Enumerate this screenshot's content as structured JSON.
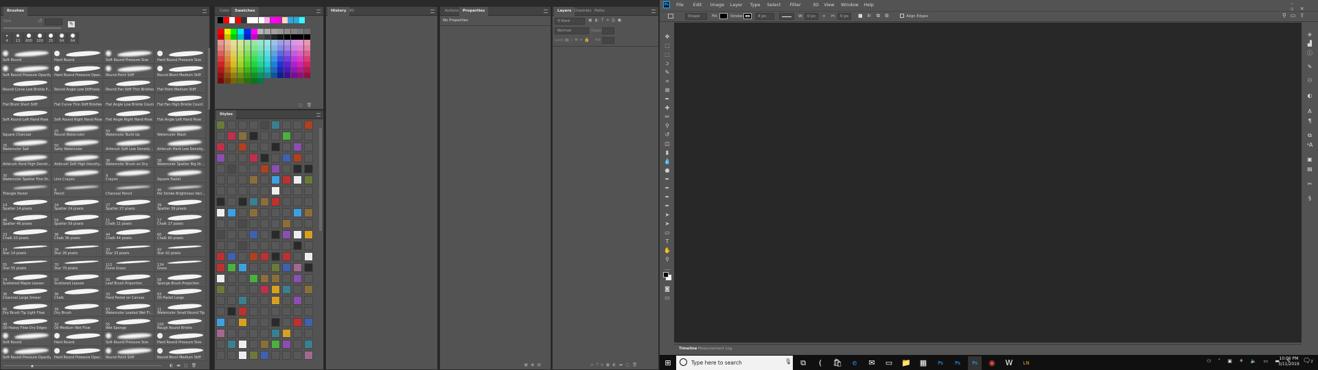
{
  "brushes_panel": {
    "tab": "Brushes",
    "size_label": "Size",
    "presets": [
      "4",
      "13",
      "600",
      "100",
      "25",
      "64",
      "64"
    ],
    "rows": [
      [
        [
          "Soft Round",
          ""
        ],
        [
          "Hard Round",
          ""
        ],
        [
          "Soft Round Pressure Size",
          ""
        ],
        [
          "Hard Round Pressure Size",
          ""
        ]
      ],
      [
        [
          "Soft Round Pressure Opacity",
          ""
        ],
        [
          "Hard Round Pressure Opacity",
          ""
        ],
        [
          "Round Point Stiff",
          ""
        ],
        [
          "Round Blunt Medium Stiff",
          ""
        ]
      ],
      [
        [
          "Round Curve Low Bristle Per...",
          ""
        ],
        [
          "Round Angle Low Stiffness",
          ""
        ],
        [
          "Round Fan Stiff Thin Bristles",
          ""
        ],
        [
          "Flat Point Medium Stiff",
          ""
        ]
      ],
      [
        [
          "Flat Blunt Short Stiff",
          ""
        ],
        [
          "Flat Curve Thin Stiff Bristles",
          ""
        ],
        [
          "Flat Angle Low Bristle Count",
          ""
        ],
        [
          "Flat Fan High Bristle Count",
          ""
        ]
      ],
      [
        [
          "Soft Round Left Hand Pose",
          ""
        ],
        [
          "Soft Round Right Hand Pose",
          ""
        ],
        [
          "Flat Angle Right Hand Pose",
          ""
        ],
        [
          "Flat Angle Left Hand Pose",
          ""
        ]
      ],
      [
        [
          "Square Charcoal",
          ""
        ],
        [
          "Round Watercolor",
          "25"
        ],
        [
          "Watercolor Build Up",
          "50"
        ],
        [
          "Watercolor Wash",
          ""
        ]
      ],
      [
        [
          "Watercolor Salt",
          "25"
        ],
        [
          "Salty Watercolor",
          "50"
        ],
        [
          "Airbrush Soft Low Density G...",
          ""
        ],
        [
          "Airbrush Hard Low Density...",
          ""
        ]
      ],
      [
        [
          "Airbrush Hard High Density...",
          ""
        ],
        [
          "Airbrush Soft High Density...",
          ""
        ],
        [
          "Watercolor Brush on Dry",
          "36"
        ],
        [
          "Watercolor Spatter Big Drops",
          "38"
        ]
      ],
      [
        [
          "Watercolor Spatter Fine Drops",
          "30"
        ],
        [
          "Lino Crayon",
          ""
        ],
        [
          "Crayon",
          "9"
        ],
        [
          "Square Pastel",
          ""
        ]
      ],
      [
        [
          "Triangle Pastel",
          ""
        ],
        [
          "Pencil",
          "9"
        ],
        [
          "Charcoal Pencil",
          ""
        ],
        [
          "Per Stroke Brightness Varia...",
          "45"
        ]
      ],
      [
        [
          "Spatter 14 pixels",
          "14"
        ],
        [
          "Spatter 24 pixels",
          "24"
        ],
        [
          "Spatter 27 pixels",
          "27"
        ],
        [
          "Spatter 39 pixels",
          "39"
        ]
      ],
      [
        [
          "Spatter 46 pixels",
          "46"
        ],
        [
          "Spatter 59 pixels",
          "59"
        ],
        [
          "Chalk 11 pixels",
          "11"
        ],
        [
          "Chalk 17 pixels",
          "17"
        ]
      ],
      [
        [
          "Chalk 23 pixels",
          "23"
        ],
        [
          "Chalk 36 pixels",
          "36"
        ],
        [
          "Chalk 44 pixels",
          "44"
        ],
        [
          "Chalk 60 pixels",
          "60"
        ]
      ],
      [
        [
          "Star 14 pixels",
          "14"
        ],
        [
          "Star 26 pixels",
          "26"
        ],
        [
          "Star 33 pixels",
          "33"
        ],
        [
          "Star 42 pixels",
          "42"
        ]
      ],
      [
        [
          "Star 55 pixels",
          "55"
        ],
        [
          "Star 70 pixels",
          "70"
        ],
        [
          "Dune Grass",
          "112"
        ],
        [
          "Grass",
          "134"
        ]
      ],
      [
        [
          "Scattered Maple Leaves",
          "74"
        ],
        [
          "Scattered Leaves",
          "55"
        ],
        [
          "Leaf Brush Projection",
          "55"
        ],
        [
          "Sponge Brush Projection",
          "58"
        ]
      ],
      [
        [
          "Charcoal Large Smear",
          "36"
        ],
        [
          "Chalk",
          "36"
        ],
        [
          "Hard Pastel on Canvas",
          "33"
        ],
        [
          "Oil Pastel Large",
          "63"
        ]
      ],
      [
        [
          "Dry Brush Tip Light Flow",
          "66"
        ],
        [
          "Dry Brush",
          "39"
        ],
        [
          "Watercolor Loaded Wet Flat...",
          "63"
        ],
        [
          "Watercolor Small Round Tip",
          "11"
        ]
      ],
      [
        [
          "Oil Heavy Flow Dry Edges",
          "48"
        ],
        [
          "Oil Medium Wet Flow",
          "32"
        ],
        [
          "Wet Sponge",
          "55"
        ],
        [
          "Rough Round Bristle",
          "100"
        ]
      ],
      [
        [
          "Soft Round",
          ""
        ],
        [
          "Hard Round",
          ""
        ],
        [
          "Soft Round Pressure Size",
          ""
        ],
        [
          "Hard Round Pressure Size",
          ""
        ]
      ],
      [
        [
          "Soft Round Pressure Opacity",
          ""
        ],
        [
          "Hard Round Pressure Opacity",
          ""
        ],
        [
          "Round Point Stiff",
          ""
        ],
        [
          "Round Blunt Medium Stiff",
          ""
        ]
      ]
    ]
  },
  "color_panel": {
    "tabs": [
      "Color",
      "Swatches"
    ],
    "active": "Swatches",
    "recent": [
      "#000000",
      "#ff0000",
      "#ffffff",
      "#ff0000",
      "#333333",
      "#ffffff",
      "#ffffff",
      "#ffffff",
      "#f9a7e8",
      "#ff00ff",
      "#ff00dd",
      "#ffd6c0",
      "#29a8e0",
      "#29a8e0",
      "#33ffff"
    ]
  },
  "styles_panel": {
    "tab": "Styles"
  },
  "history_panel": {
    "tabs": [
      "History",
      "3D"
    ]
  },
  "properties_panel": {
    "tabs": [
      "Actions",
      "Properties"
    ],
    "message": "No Properties"
  },
  "layers_panel": {
    "tabs": [
      "Layers",
      "Channels",
      "Paths"
    ],
    "kind_placeholder": "Kind",
    "blend_mode": "Normal",
    "opacity_label": "Opacity:",
    "lock_label": "Lock:",
    "fill_label": "Fill:"
  },
  "app": {
    "logo": "Ps",
    "menu": [
      "File",
      "Edit",
      "Image",
      "Layer",
      "Type",
      "Select",
      "Filter",
      "3D",
      "View",
      "Window",
      "Help"
    ]
  },
  "options": {
    "mode": "Shape",
    "fill_label": "Fill:",
    "stroke_label": "Stroke:",
    "stroke_width": "4 px",
    "w_label": "W:",
    "w_value": "0 px",
    "h_label": "H:",
    "h_value": "0 px",
    "align_edges": "Align Edges",
    "fill_color": "#000000"
  },
  "bottom_panel": {
    "tabs": [
      "Timeline",
      "Measurement Log"
    ]
  },
  "taskbar": {
    "search_placeholder": "Type here to search",
    "time": "10:06 PM",
    "date": "3/11/2019",
    "notifications": "2",
    "apps": [
      "task-view",
      "cortana",
      "store",
      "edge",
      "mail",
      "terminal",
      "file-explorer",
      "calculator",
      "photoshop",
      "photoshop",
      "photoshop",
      "chrome",
      "app-w",
      "app-ln"
    ]
  }
}
